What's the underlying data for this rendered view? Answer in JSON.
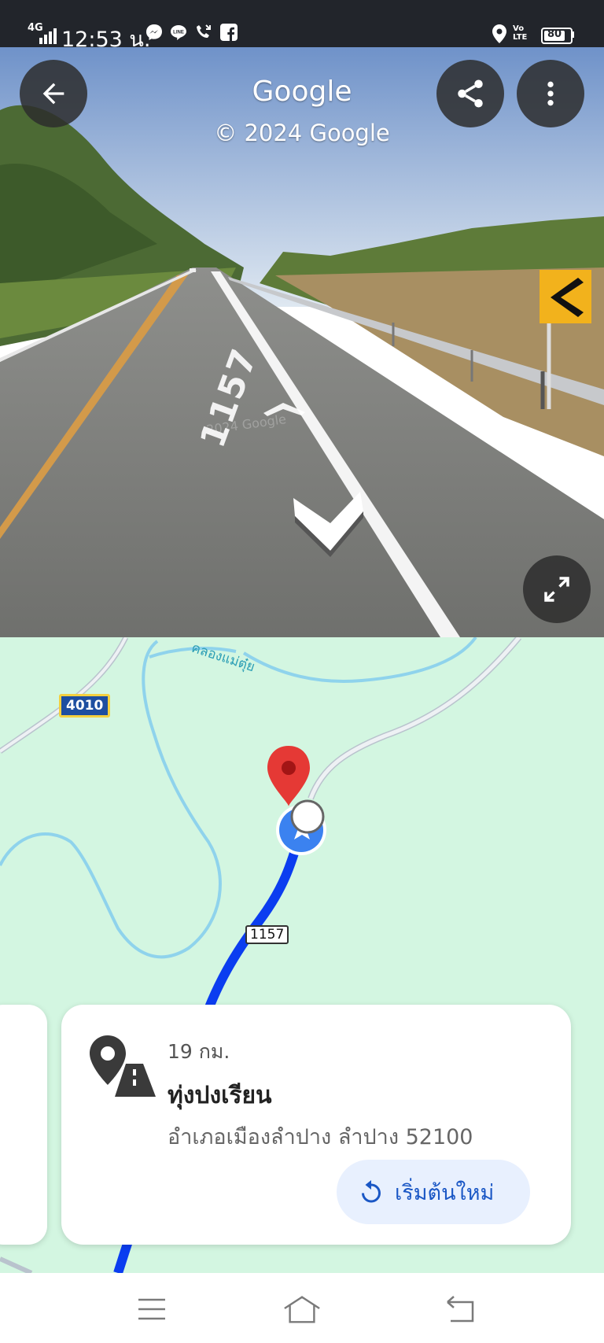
{
  "status_bar": {
    "network": "4G",
    "time": "12:53 น.",
    "battery": "80",
    "volte": "Vo LTE"
  },
  "street_view": {
    "title": "Google",
    "copyright": "© 2024 Google",
    "road_marking": "1157",
    "watermark": "2024 Google"
  },
  "map": {
    "river_label": "คลองแม่ตุ๋ย",
    "shield_4010": "4010",
    "route_1157": "1157"
  },
  "place_card": {
    "distance": "19 กม.",
    "name": "ทุ่งปงเรียน",
    "address": "อำเภอเมืองลำปาง ลำปาง 52100",
    "restart_label": "เริ่มต้นใหม่"
  },
  "colors": {
    "status_bar_bg": "#22252b",
    "map_bg": "#d3f6e1",
    "route_blue": "#0b3df0",
    "pin_red": "#e53935",
    "accent_blue": "#1a57c5"
  }
}
